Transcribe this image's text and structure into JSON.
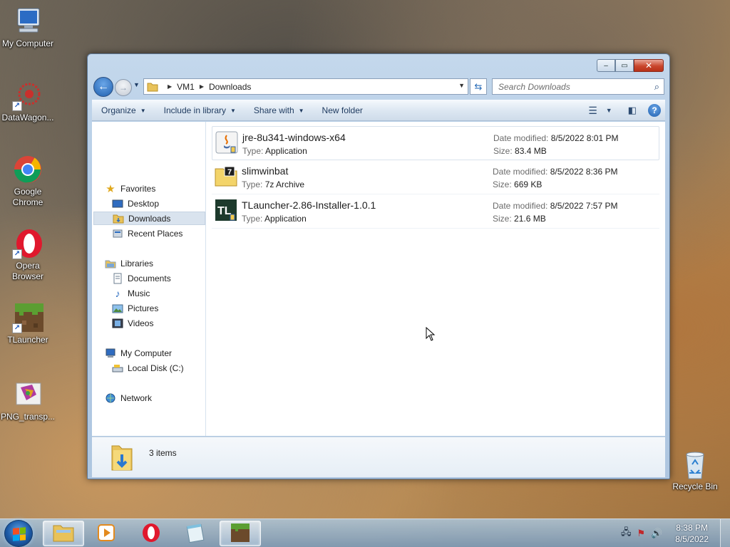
{
  "desktop": {
    "icons": [
      {
        "label": "My Computer",
        "icon": "computer-icon"
      },
      {
        "label": "DataWagon...",
        "icon": "datawagon-icon"
      },
      {
        "label": "Google Chrome",
        "icon": "chrome-icon"
      },
      {
        "label": "Opera Browser",
        "icon": "opera-icon"
      },
      {
        "label": "TLauncher",
        "icon": "tlauncher-icon"
      },
      {
        "label": "PNG_transp...",
        "icon": "png-file-icon"
      },
      {
        "label": "Recycle Bin",
        "icon": "recycle-bin-icon"
      }
    ]
  },
  "window": {
    "controls": {
      "minimize": "–",
      "maximize": "▭",
      "close": "✕"
    },
    "address": {
      "crumbs": [
        "VM1",
        "Downloads"
      ]
    },
    "search": {
      "placeholder": "Search Downloads"
    },
    "toolbar": {
      "organize": "Organize",
      "include_in_library": "Include in library",
      "share_with": "Share with",
      "new_folder": "New folder"
    },
    "nav": {
      "favorites": "Favorites",
      "desktop": "Desktop",
      "downloads": "Downloads",
      "recent_places": "Recent Places",
      "libraries": "Libraries",
      "documents": "Documents",
      "music": "Music",
      "pictures": "Pictures",
      "videos": "Videos",
      "my_computer": "My Computer",
      "local_disk": "Local Disk (C:)",
      "network": "Network"
    },
    "labels": {
      "type": "Type:",
      "date_modified": "Date modified:",
      "size": "Size:"
    },
    "files": [
      {
        "name": "jre-8u341-windows-x64",
        "type": "Application",
        "date": "8/5/2022 8:01 PM",
        "size": "83.4 MB",
        "icon": "java-installer-icon"
      },
      {
        "name": "slimwinbat",
        "type": "7z Archive",
        "date": "8/5/2022 8:36 PM",
        "size": "669 KB",
        "icon": "7z-archive-icon"
      },
      {
        "name": "TLauncher-2.86-Installer-1.0.1",
        "type": "Application",
        "date": "8/5/2022 7:57 PM",
        "size": "21.6 MB",
        "icon": "tlauncher-installer-icon"
      }
    ],
    "details": {
      "count": "3 items"
    }
  },
  "taskbar": {
    "clock": {
      "time": "8:38 PM",
      "date": "8/5/2022"
    },
    "pinned": [
      "explorer-icon",
      "media-player-icon",
      "opera-icon",
      "notepad-icon",
      "minecraft-icon"
    ]
  },
  "colors": {
    "accent": "#1f5fae",
    "close_red": "#c9462c",
    "selection": "#d9e3ee"
  }
}
